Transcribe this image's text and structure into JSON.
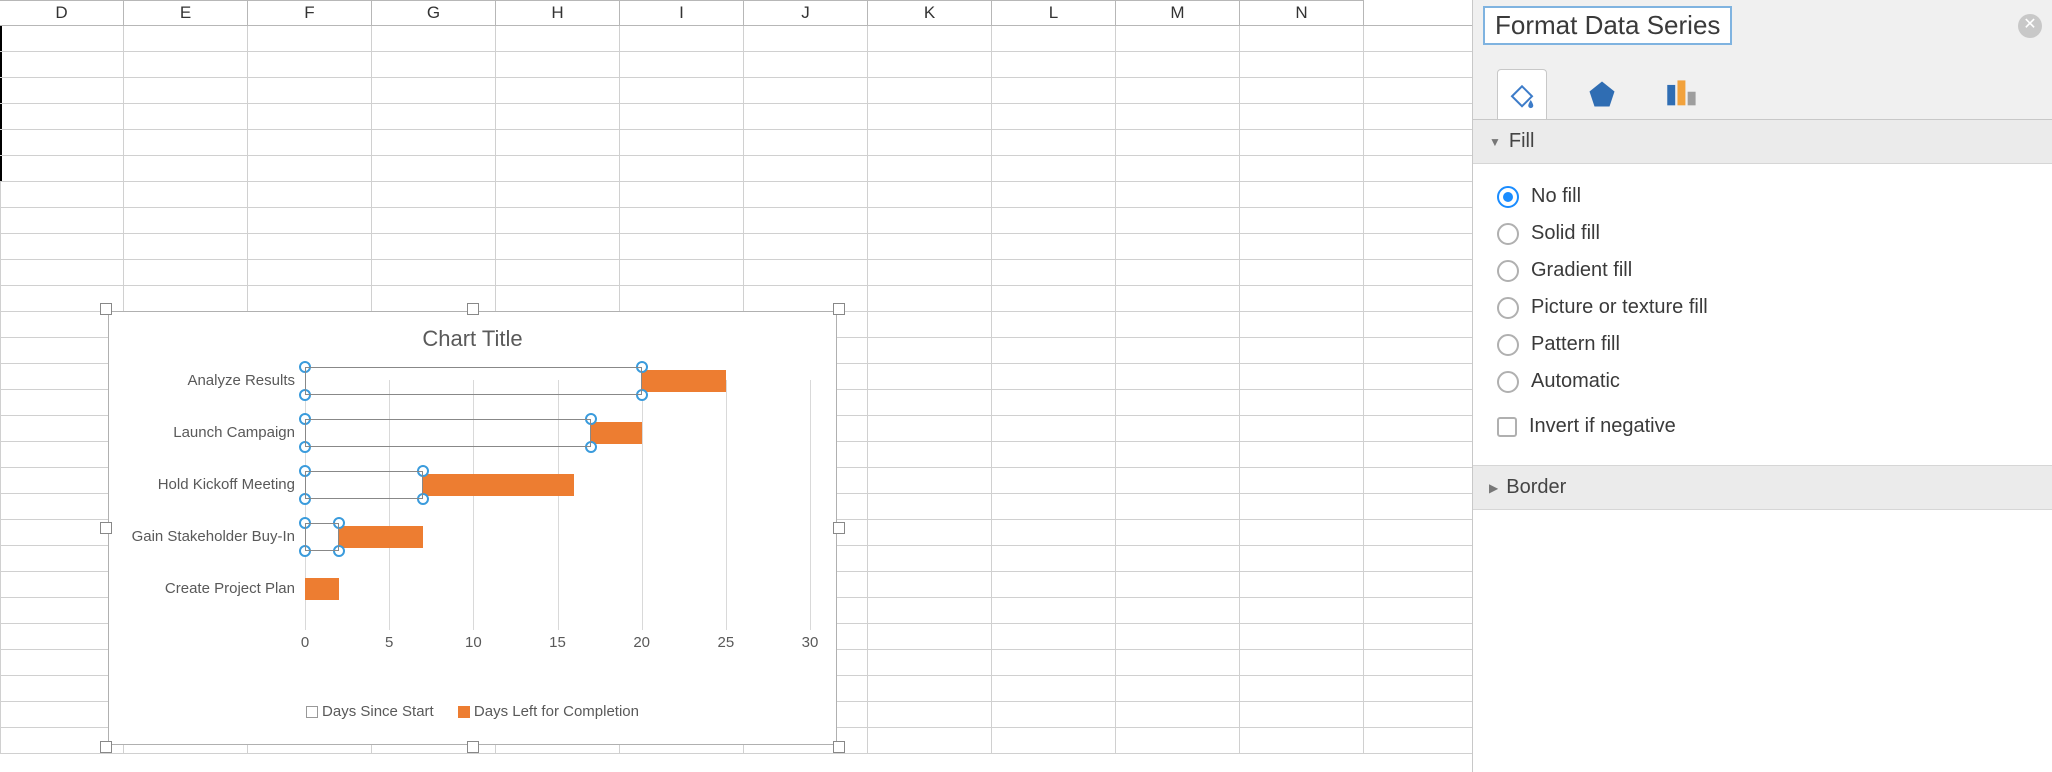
{
  "columns": [
    "D",
    "E",
    "F",
    "G",
    "H",
    "I",
    "J",
    "K",
    "L",
    "M",
    "N"
  ],
  "chart": {
    "title": "Chart Title",
    "legend": {
      "series1": "Days Since Start",
      "series2": "Days Left for Completion"
    },
    "xaxis_ticks": [
      "0",
      "5",
      "10",
      "15",
      "20",
      "25",
      "30"
    ]
  },
  "chart_data": {
    "type": "bar",
    "orientation": "horizontal",
    "stacked": true,
    "title": "Chart Title",
    "ylabel": "",
    "xlabel": "",
    "xlim": [
      0,
      30
    ],
    "categories": [
      "Analyze Results",
      "Launch Campaign",
      "Hold Kickoff Meeting",
      "Gain Stakeholder Buy-In",
      "Create Project Plan"
    ],
    "series": [
      {
        "name": "Days Since Start",
        "values": [
          20,
          17,
          7,
          2,
          0
        ],
        "fill": "none",
        "selected": true
      },
      {
        "name": "Days Left for Completion",
        "values": [
          5,
          3,
          9,
          5,
          2
        ],
        "fill": "#ed7d31"
      }
    ],
    "legend_position": "bottom"
  },
  "pane": {
    "title": "Format Data Series",
    "sections": {
      "fill": "Fill",
      "border": "Border"
    },
    "fill_options": {
      "no_fill": "No fill",
      "solid_fill": "Solid fill",
      "gradient_fill": "Gradient fill",
      "picture_fill": "Picture or texture fill",
      "pattern_fill": "Pattern fill",
      "automatic": "Automatic"
    },
    "invert_label": "Invert if negative",
    "selected_fill": "no_fill"
  }
}
